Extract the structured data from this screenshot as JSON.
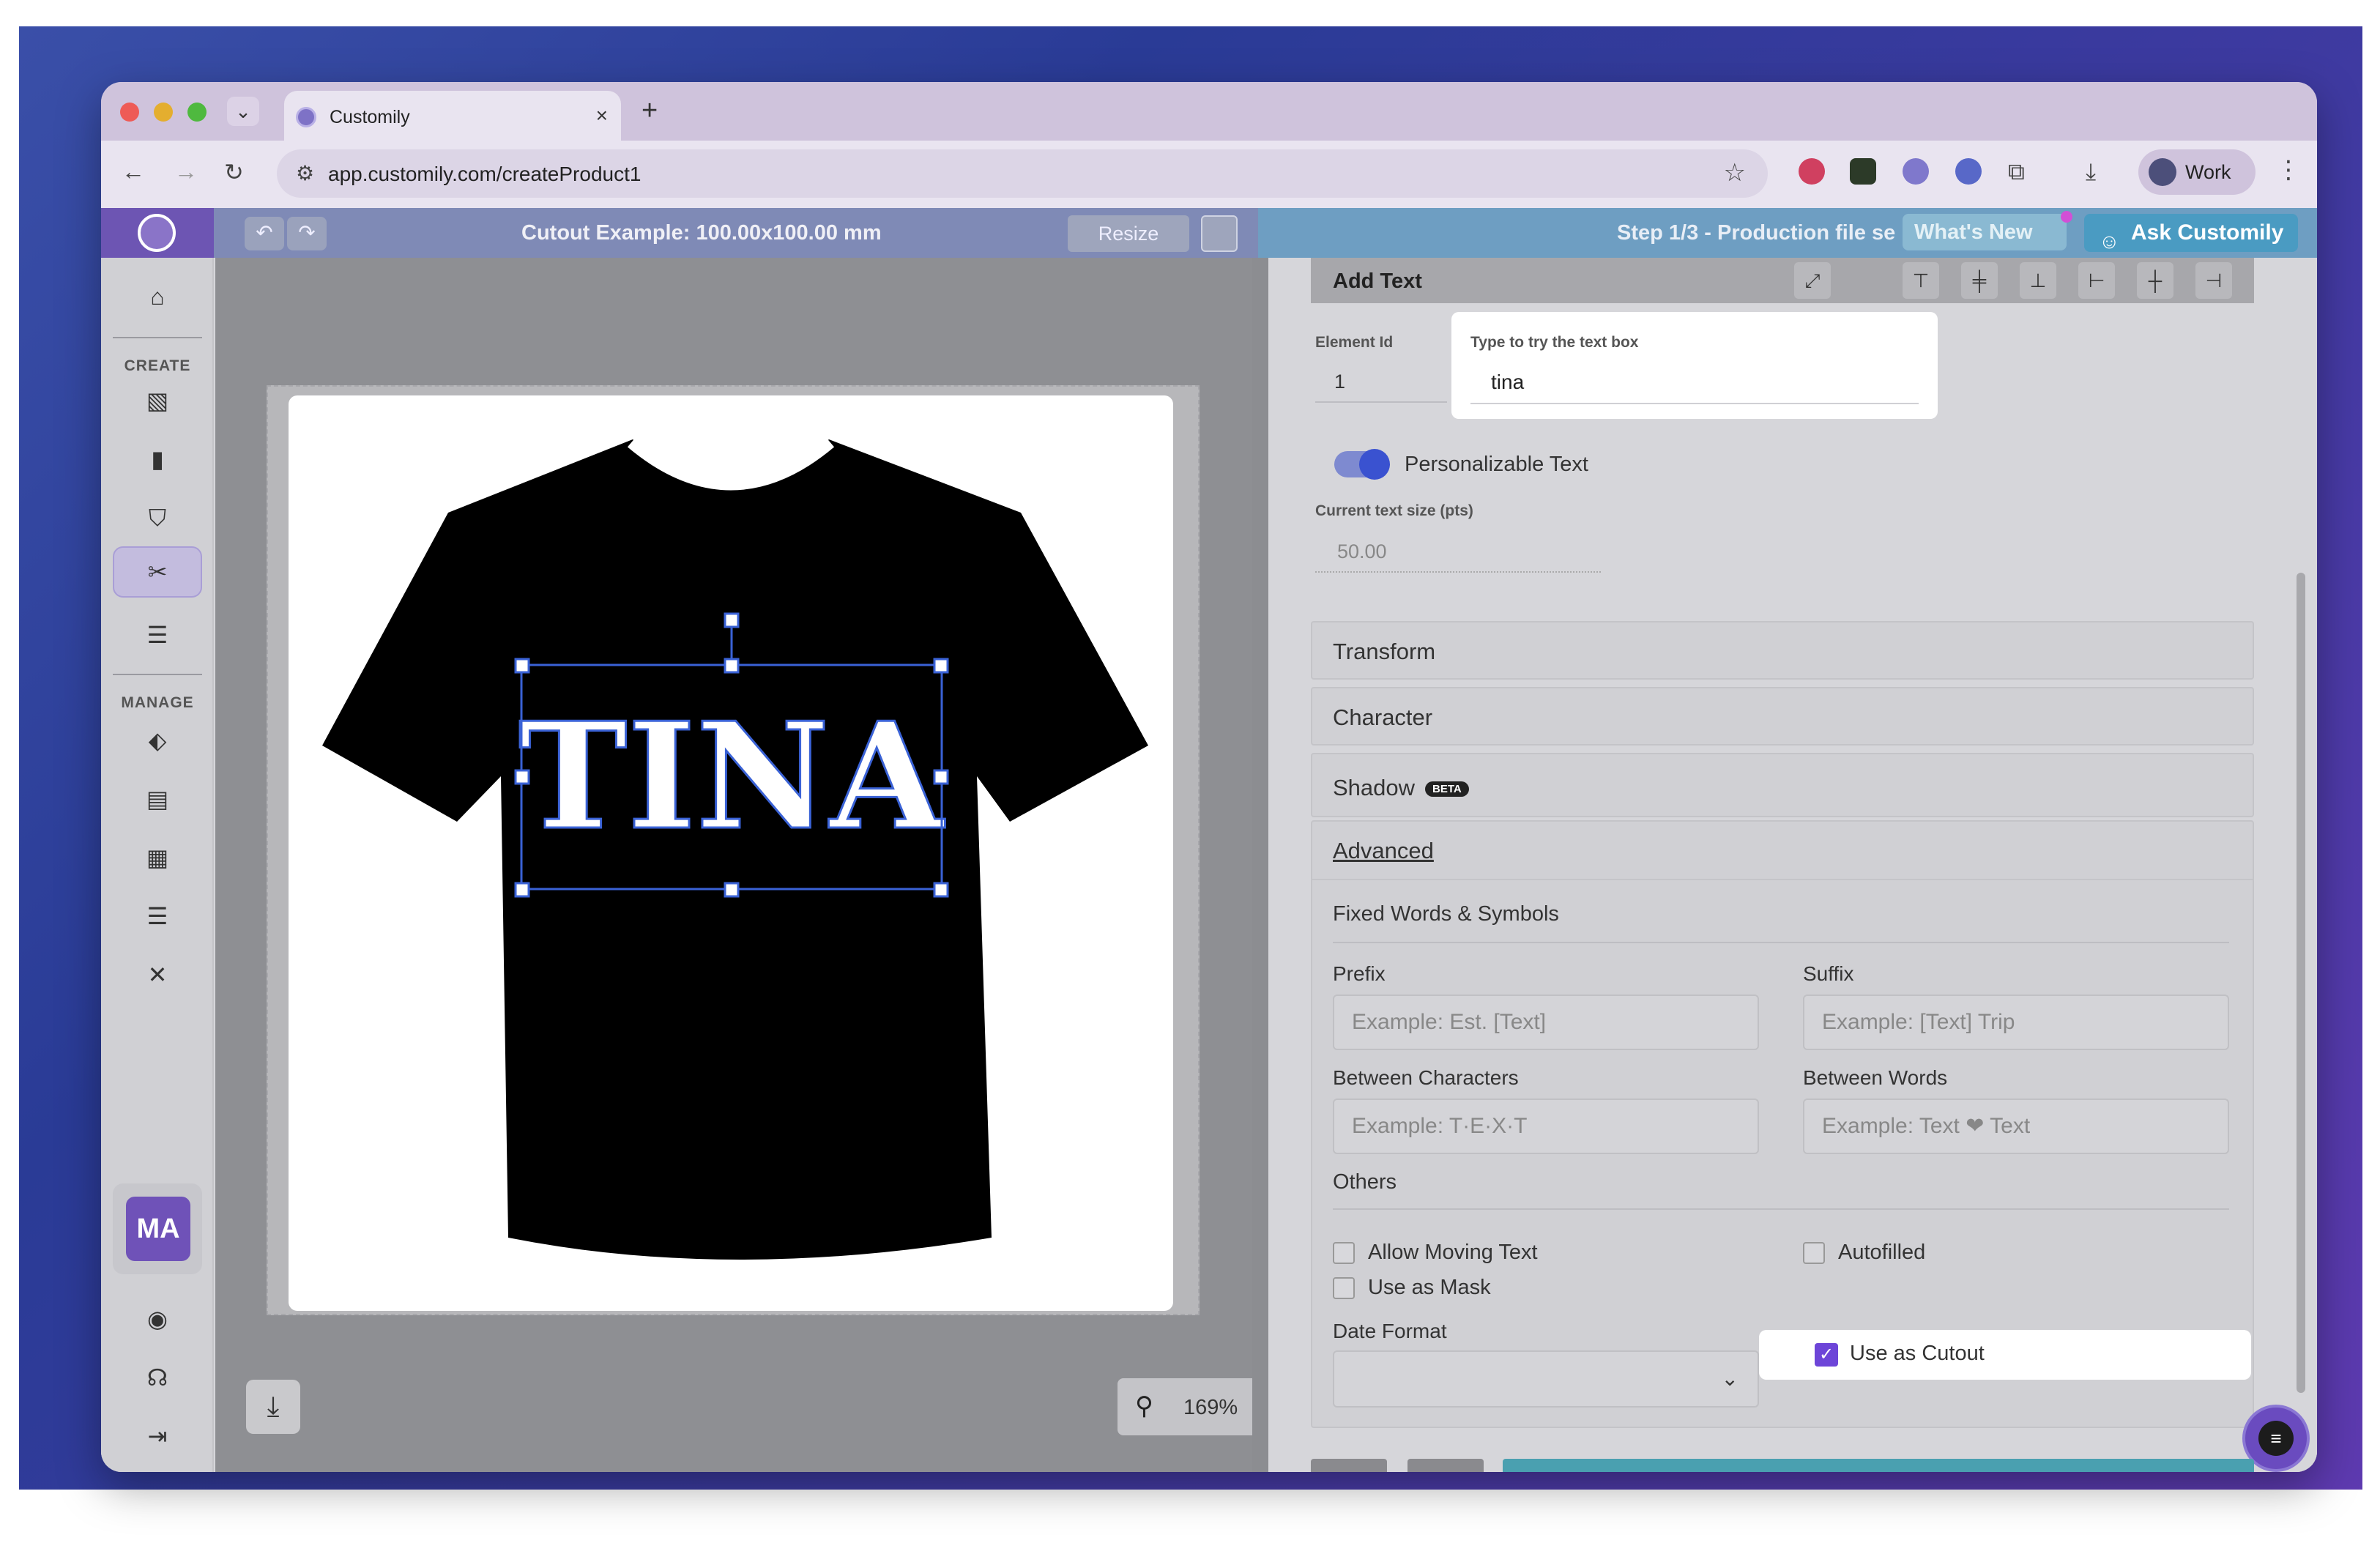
{
  "browser": {
    "tab_title": "Customily",
    "tab_close": "×",
    "new_tab": "+",
    "tab_dropdown": "⌄",
    "url": "app.customily.com/createProduct1",
    "profile_label": "Work"
  },
  "app": {
    "canvas_title": "Cutout Example: 100.00x100.00 mm",
    "resize_label": "Resize",
    "step_label": "Step 1/3 - Production file se",
    "whats_new_label": "What's New",
    "ask_label": "Ask Customily",
    "zoom_value": "169%"
  },
  "sidebar": {
    "create_label": "CREATE",
    "manage_label": "MANAGE",
    "avatar_initials": "MA",
    "create_items": [
      "product-icon",
      "paint-icon",
      "tshirt-icon",
      "cutout-tool-icon",
      "list-icon"
    ],
    "manage_items": [
      "tag-icon",
      "document-icon",
      "table-icon",
      "list-icon",
      "tools-icon"
    ],
    "bottom_items": [
      "account-icon",
      "support-icon",
      "logout-icon"
    ]
  },
  "design": {
    "text": "TINA",
    "shirt_color": "#000000",
    "text_color": "#ffffff",
    "selection_color": "#3a62d6"
  },
  "panel": {
    "section_title": "Add Text",
    "element_id_label": "Element Id",
    "element_id_value": "1",
    "try_label": "Type to try the text box",
    "try_value": "tina",
    "personalizable_label": "Personalizable Text",
    "personalizable_on": true,
    "text_size_label": "Current text size (pts)",
    "text_size_value": "50.00",
    "accordions": {
      "transform": "Transform",
      "character": "Character",
      "shadow": "Shadow",
      "shadow_badge": "BETA",
      "advanced": "Advanced"
    },
    "advanced": {
      "fixed_title": "Fixed Words & Symbols",
      "prefix_label": "Prefix",
      "prefix_placeholder": "Example: Est. [Text]",
      "suffix_label": "Suffix",
      "suffix_placeholder": "Example: [Text] Trip",
      "between_chars_label": "Between Characters",
      "between_chars_placeholder": "Example: T·E·X·T",
      "between_words_label": "Between Words",
      "between_words_placeholder": "Example: Text ❤ Text",
      "others_title": "Others",
      "allow_moving_label": "Allow Moving Text",
      "allow_moving_checked": false,
      "autofilled_label": "Autofilled",
      "autofilled_checked": false,
      "use_as_mask_label": "Use as Mask",
      "use_as_mask_checked": false,
      "use_as_cutout_label": "Use as Cutout",
      "use_as_cutout_checked": true,
      "date_format_label": "Date Format",
      "date_format_value": ""
    }
  }
}
